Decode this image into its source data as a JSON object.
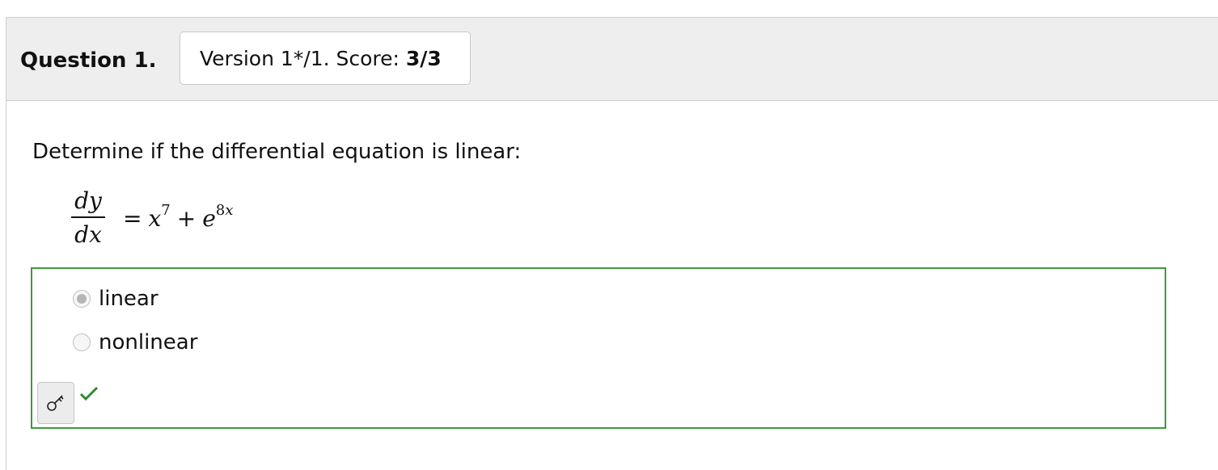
{
  "question": {
    "title": "Question 1.",
    "version_text": "Version 1*/1. Score: ",
    "score": "3/3"
  },
  "prompt": "Determine if the differential equation is linear:",
  "equation": {
    "numerator": "dy",
    "denominator": "dx",
    "equals": "=",
    "base1": "x",
    "exp1": "7",
    "plus": "+",
    "base2": "e",
    "exp2_num": "8",
    "exp2_var": "x"
  },
  "options": [
    {
      "label": "linear",
      "selected": true
    },
    {
      "label": "nonlinear",
      "selected": false
    }
  ],
  "feedback": {
    "status": "correct",
    "check_color": "#2e8b2e",
    "border_color": "#3c9a3c"
  },
  "icons": {
    "key_button": "key-icon",
    "status": "checkmark-icon"
  }
}
